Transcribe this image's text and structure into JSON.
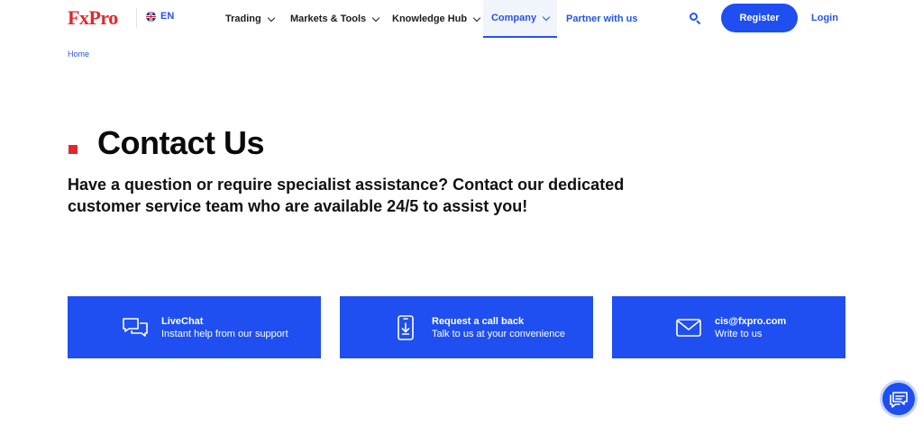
{
  "header": {
    "logo": "FxPro",
    "language": "EN",
    "nav": [
      {
        "label": "Trading"
      },
      {
        "label": "Markets & Tools"
      },
      {
        "label": "Knowledge Hub"
      },
      {
        "label": "Company"
      },
      {
        "label": "Partner with us"
      }
    ],
    "register_label": "Register",
    "login_label": "Login"
  },
  "breadcrumb": {
    "home": "Home"
  },
  "hero": {
    "title": "Contact Us",
    "subtitle": "Have a question or require specialist assistance? Contact our dedicated customer service team who are available 24/5 to assist you!"
  },
  "cards": [
    {
      "title": "LiveChat",
      "desc": "Instant help from our support",
      "icon": "chat-bubbles-icon"
    },
    {
      "title": "Request a call back",
      "desc": "Talk to us at your convenience",
      "icon": "phone-download-icon"
    },
    {
      "title": "cis@fxpro.com",
      "desc": "Write to us",
      "icon": "envelope-icon"
    }
  ],
  "colors": {
    "brand_red": "#e0282c",
    "accent_blue": "#1f4ff0"
  }
}
